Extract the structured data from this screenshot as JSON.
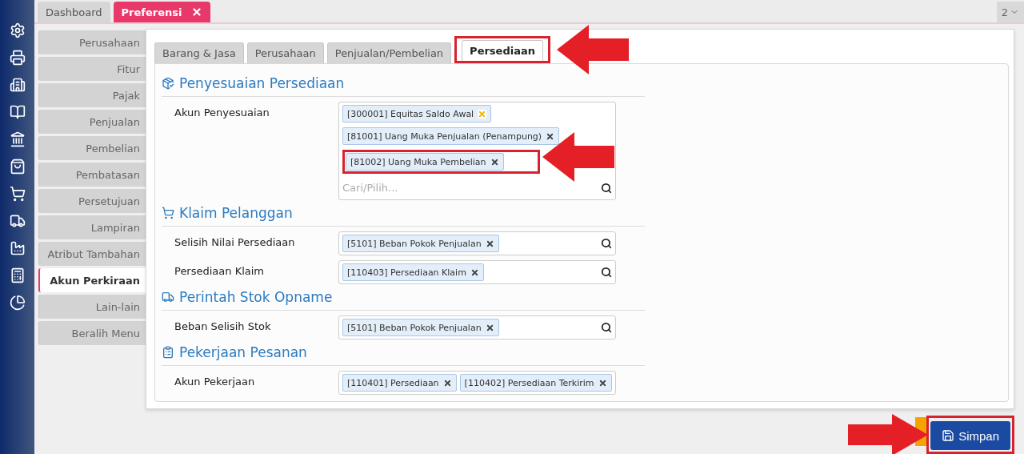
{
  "top_tabs": [
    {
      "label": "Dashboard",
      "selected": false,
      "closable": false
    },
    {
      "label": "Preferensi",
      "selected": true,
      "closable": true
    }
  ],
  "tab_count": "2",
  "side_menu": [
    {
      "label": "Perusahaan",
      "selected": false
    },
    {
      "label": "Fitur",
      "selected": false
    },
    {
      "label": "Pajak",
      "selected": false
    },
    {
      "label": "Penjualan",
      "selected": false
    },
    {
      "label": "Pembelian",
      "selected": false
    },
    {
      "label": "Pembatasan",
      "selected": false
    },
    {
      "label": "Persetujuan",
      "selected": false
    },
    {
      "label": "Lampiran",
      "selected": false
    },
    {
      "label": "Atribut Tambahan",
      "selected": false
    },
    {
      "label": "Akun Perkiraan",
      "selected": true
    },
    {
      "label": "Lain-lain",
      "selected": false
    },
    {
      "label": "Beralih Menu",
      "selected": false
    }
  ],
  "sub_tabs": [
    {
      "label": "Barang & Jasa",
      "selected": false,
      "highlighted": false
    },
    {
      "label": "Perusahaan",
      "selected": false,
      "highlighted": false
    },
    {
      "label": "Penjualan/Pembelian",
      "selected": false,
      "highlighted": false
    },
    {
      "label": "Persediaan",
      "selected": true,
      "highlighted": true
    }
  ],
  "sections": [
    {
      "title": "Penyesuaian Persediaan",
      "kind": "adjust",
      "fields": [
        {
          "label": "Akun Penyesuaian",
          "placeholder": "Cari/Pilih...",
          "values": [
            {
              "text": "[300001] Equitas Saldo Awal",
              "highlighted": false,
              "hovered": true
            },
            {
              "text": "[81001] Uang Muka Penjualan (Penampung)",
              "highlighted": false,
              "hovered": false
            },
            {
              "text": "[81002] Uang Muka Pembelian",
              "highlighted": true,
              "hovered": false
            }
          ]
        }
      ]
    },
    {
      "title": "Klaim Pelanggan",
      "kind": "cart",
      "fields": [
        {
          "label": "Selisih Nilai Persediaan",
          "values": [
            {
              "text": "[5101] Beban Pokok Penjualan",
              "highlighted": false,
              "hovered": false
            }
          ]
        },
        {
          "label": "Persediaan Klaim",
          "values": [
            {
              "text": "[110403] Persediaan Klaim",
              "highlighted": false,
              "hovered": false
            }
          ]
        }
      ]
    },
    {
      "title": "Perintah Stok Opname",
      "kind": "trolley",
      "fields": [
        {
          "label": "Beban Selisih Stok",
          "values": [
            {
              "text": "[5101] Beban Pokok Penjualan",
              "highlighted": false,
              "hovered": false
            }
          ]
        }
      ]
    },
    {
      "title": "Pekerjaan Pesanan",
      "kind": "job",
      "fields": [
        {
          "label": "Akun Pekerjaan",
          "values": [
            {
              "text": "[110401] Persediaan",
              "highlighted": false,
              "hovered": false
            },
            {
              "text": "[110402] Persediaan Terkirim",
              "highlighted": false,
              "hovered": false
            }
          ]
        }
      ]
    }
  ],
  "save_button": {
    "label": "Simpan",
    "highlighted": true
  }
}
